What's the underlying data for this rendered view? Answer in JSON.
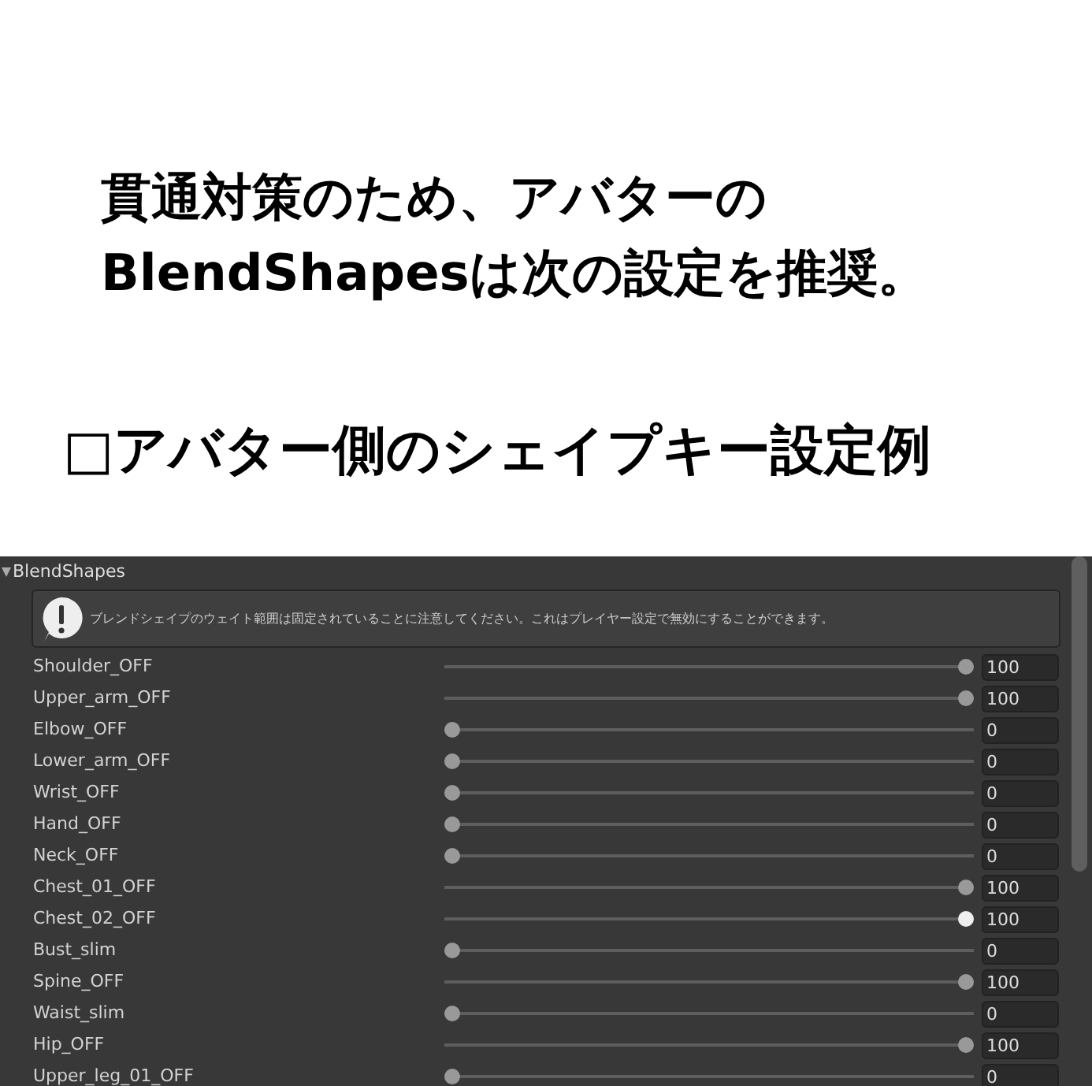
{
  "intro": {
    "lines": [
      "貫通対策のため、アバターの",
      "BlendShapesは次の設定を推奨。"
    ]
  },
  "section_heading": "□アバター側のシェイプキー設定例",
  "panel": {
    "title": "BlendShapes",
    "expanded": true,
    "notice": "ブレンドシェイプのウェイト範囲は固定されていることに注意してください。これはプレイヤー設定で無効にすることができます。",
    "rows": [
      {
        "name": "Shoulder_OFF",
        "level": 1,
        "value": "100",
        "focused": false
      },
      {
        "name": "Upper_arm_OFF",
        "level": 1,
        "value": "100",
        "focused": false
      },
      {
        "name": "Elbow_OFF",
        "level": 0,
        "value": "0",
        "focused": false
      },
      {
        "name": "Lower_arm_OFF",
        "level": 0,
        "value": "0",
        "focused": false
      },
      {
        "name": "Wrist_OFF",
        "level": 0,
        "value": "0",
        "focused": false
      },
      {
        "name": "Hand_OFF",
        "level": 0,
        "value": "0",
        "focused": false
      },
      {
        "name": "Neck_OFF",
        "level": 0,
        "value": "0",
        "focused": false
      },
      {
        "name": "Chest_01_OFF",
        "level": 1,
        "value": "100",
        "focused": false
      },
      {
        "name": "Chest_02_OFF",
        "level": 1,
        "value": "100",
        "focused": true
      },
      {
        "name": "Bust_slim",
        "level": 0,
        "value": "0",
        "focused": false
      },
      {
        "name": "Spine_OFF",
        "level": 1,
        "value": "100",
        "focused": false
      },
      {
        "name": "Waist_slim",
        "level": 0,
        "value": "0",
        "focused": false
      },
      {
        "name": "Hip_OFF",
        "level": 1,
        "value": "100",
        "focused": false
      },
      {
        "name": "Upper_leg_01_OFF",
        "level": 0,
        "value": "0",
        "focused": false
      }
    ]
  }
}
